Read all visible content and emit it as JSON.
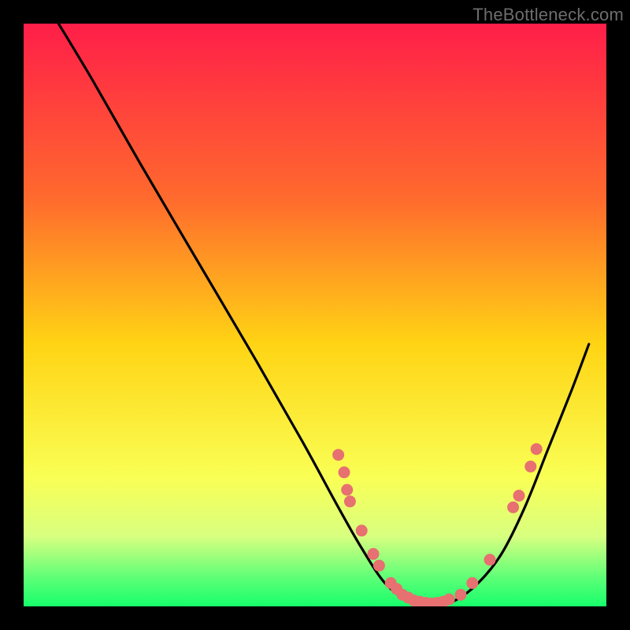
{
  "watermark_text": "TheBottleneck.com",
  "chart_data": {
    "type": "line",
    "title": "",
    "xlabel": "",
    "ylabel": "",
    "xlim": [
      0,
      100
    ],
    "ylim": [
      0,
      100
    ],
    "gradient_stops": [
      {
        "offset": 0,
        "color": "#ff1e49"
      },
      {
        "offset": 0.3,
        "color": "#ff6a2d"
      },
      {
        "offset": 0.55,
        "color": "#ffd414"
      },
      {
        "offset": 0.78,
        "color": "#f9ff55"
      },
      {
        "offset": 0.88,
        "color": "#d8ff80"
      },
      {
        "offset": 0.95,
        "color": "#5fff77"
      },
      {
        "offset": 1.0,
        "color": "#17ff6b"
      }
    ],
    "curve": [
      {
        "x": 6,
        "y": 100
      },
      {
        "x": 12,
        "y": 90
      },
      {
        "x": 20,
        "y": 76
      },
      {
        "x": 30,
        "y": 59
      },
      {
        "x": 40,
        "y": 42
      },
      {
        "x": 48,
        "y": 28
      },
      {
        "x": 54,
        "y": 17
      },
      {
        "x": 58,
        "y": 10
      },
      {
        "x": 62,
        "y": 4
      },
      {
        "x": 66,
        "y": 1
      },
      {
        "x": 70,
        "y": 0
      },
      {
        "x": 74,
        "y": 1
      },
      {
        "x": 78,
        "y": 4
      },
      {
        "x": 82,
        "y": 9
      },
      {
        "x": 86,
        "y": 17
      },
      {
        "x": 90,
        "y": 27
      },
      {
        "x": 94,
        "y": 37
      },
      {
        "x": 97,
        "y": 45
      }
    ],
    "markers": [
      {
        "x": 54,
        "y": 26
      },
      {
        "x": 55,
        "y": 23
      },
      {
        "x": 55.5,
        "y": 20
      },
      {
        "x": 56,
        "y": 18
      },
      {
        "x": 58,
        "y": 13
      },
      {
        "x": 60,
        "y": 9
      },
      {
        "x": 61,
        "y": 7
      },
      {
        "x": 63,
        "y": 4
      },
      {
        "x": 64,
        "y": 3
      },
      {
        "x": 65,
        "y": 2
      },
      {
        "x": 66,
        "y": 1.5
      },
      {
        "x": 67,
        "y": 1
      },
      {
        "x": 68,
        "y": 0.8
      },
      {
        "x": 69,
        "y": 0.6
      },
      {
        "x": 70,
        "y": 0.5
      },
      {
        "x": 71,
        "y": 0.6
      },
      {
        "x": 72,
        "y": 0.8
      },
      {
        "x": 73,
        "y": 1.2
      },
      {
        "x": 75,
        "y": 2
      },
      {
        "x": 77,
        "y": 4
      },
      {
        "x": 80,
        "y": 8
      },
      {
        "x": 84,
        "y": 17
      },
      {
        "x": 85,
        "y": 19
      },
      {
        "x": 87,
        "y": 24
      },
      {
        "x": 88,
        "y": 27
      }
    ],
    "marker_color": "#e77070",
    "curve_color": "#000000",
    "curve_width": 3.2,
    "marker_radius": 7.5
  }
}
